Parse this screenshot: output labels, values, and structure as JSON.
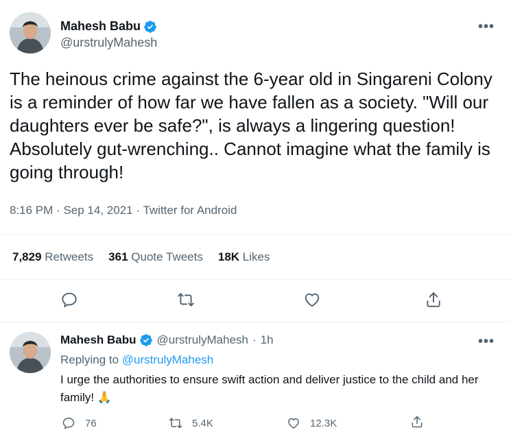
{
  "main_tweet": {
    "author": {
      "name": "Mahesh Babu",
      "handle": "@urstrulyMahesh",
      "verified": true
    },
    "more_label": "•••",
    "text": "The heinous crime against the 6-year old in Singareni Colony is a reminder of how far we have fallen as a society. \"Will our daughters ever be safe?\", is always a lingering question! Absolutely gut-wrenching.. Cannot imagine what the family is going through!",
    "time": "8:16 PM",
    "date": "Sep 14, 2021",
    "source": "Twitter for Android",
    "separator": "·",
    "stats": {
      "retweets_count": "7,829",
      "retweets_label": "Retweets",
      "quotes_count": "361",
      "quotes_label": "Quote Tweets",
      "likes_count": "18K",
      "likes_label": "Likes"
    },
    "actions": [
      "reply-icon",
      "retweet-icon",
      "like-icon",
      "share-icon"
    ]
  },
  "reply_tweet": {
    "author": {
      "name": "Mahesh Babu",
      "handle": "@urstrulyMahesh",
      "time": "1h",
      "verified": true
    },
    "separator": "·",
    "more_label": "•••",
    "replying_prefix": "Replying to",
    "replying_to": "@urstrulyMahesh",
    "text": "I urge the authorities to ensure swift action and deliver justice to the child and her family! 🙏",
    "counts": {
      "replies": "76",
      "retweets": "5.4K",
      "likes": "12.3K"
    }
  },
  "colors": {
    "text": "#0f1419",
    "secondary": "#536471",
    "accent": "#1d9bf0",
    "divider": "#eff3f4"
  }
}
